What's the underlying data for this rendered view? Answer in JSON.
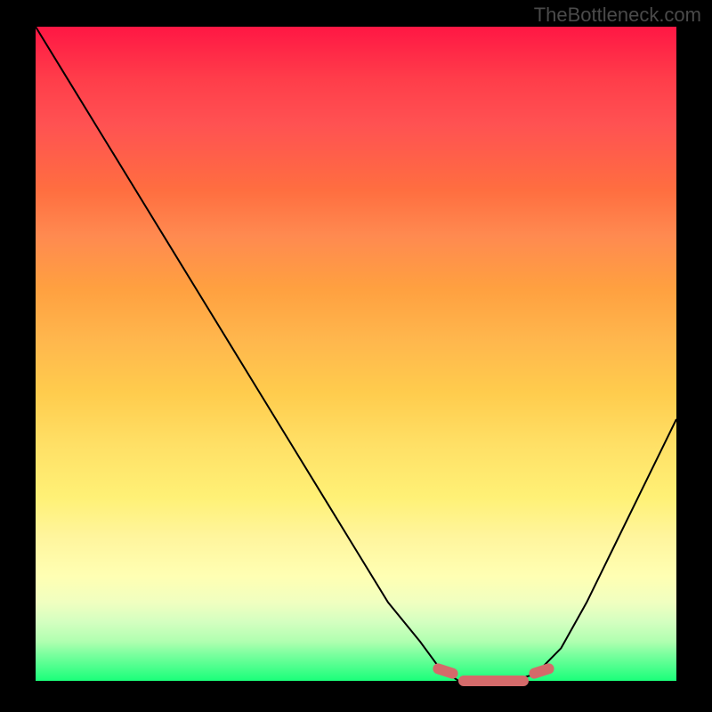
{
  "watermark": "TheBottleneck.com",
  "chart_data": {
    "type": "line",
    "title": "",
    "xlabel": "",
    "ylabel": "",
    "xlim": [
      0,
      100
    ],
    "ylim": [
      0,
      100
    ],
    "grid": false,
    "series": [
      {
        "name": "bottleneck-curve",
        "x": [
          0,
          5,
          10,
          15,
          20,
          25,
          30,
          35,
          40,
          45,
          50,
          55,
          60,
          63,
          66,
          70,
          74,
          78,
          82,
          86,
          90,
          94,
          98,
          100
        ],
        "values": [
          100,
          92,
          84,
          76,
          68,
          60,
          52,
          44,
          36,
          28,
          20,
          12,
          6,
          2,
          0,
          0,
          0,
          1,
          5,
          12,
          20,
          28,
          36,
          40
        ],
        "color": "#000000"
      }
    ],
    "highlight_ranges": [
      {
        "start": 62,
        "end": 66,
        "y": 1.5
      },
      {
        "start": 66,
        "end": 77,
        "y": 0
      },
      {
        "start": 77,
        "end": 81,
        "y": 1.5
      }
    ],
    "gradient_stops": [
      {
        "pos": 0,
        "color": "#ff1744"
      },
      {
        "pos": 50,
        "color": "#ffcc4d"
      },
      {
        "pos": 85,
        "color": "#ffffb3"
      },
      {
        "pos": 100,
        "color": "#1aff7a"
      }
    ]
  }
}
